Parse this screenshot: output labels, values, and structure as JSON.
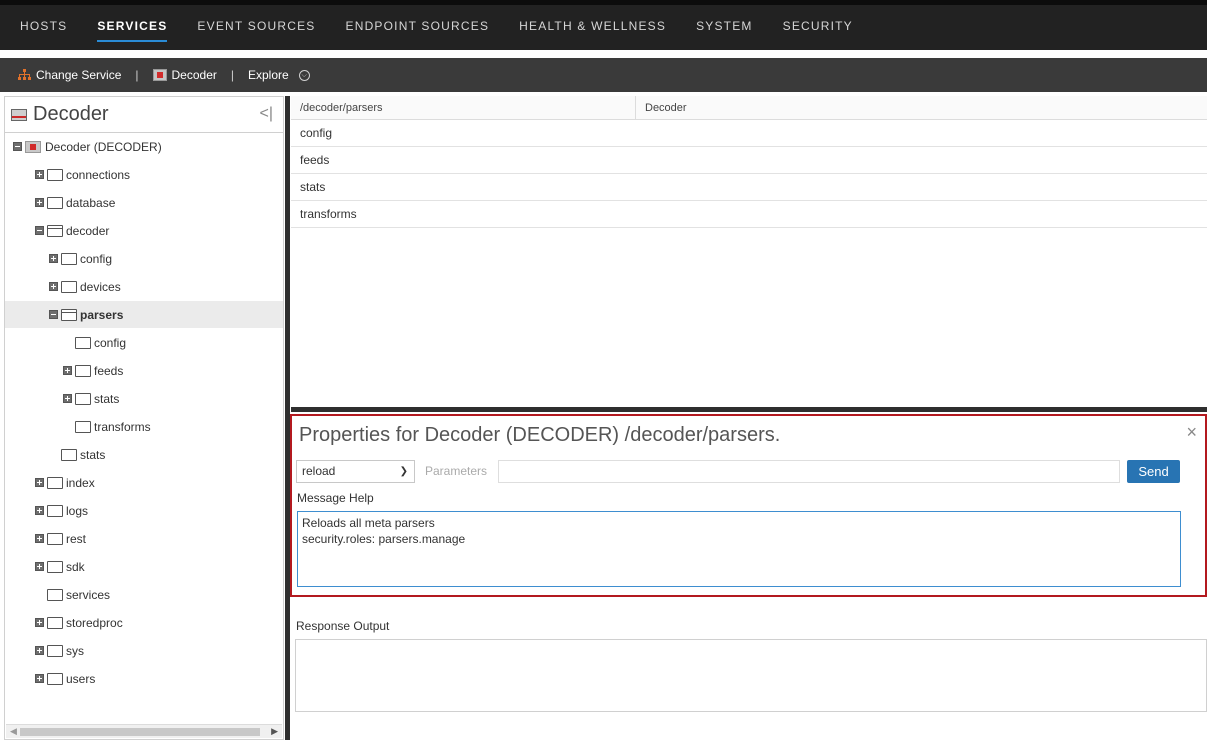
{
  "topnav": {
    "tabs": [
      "HOSTS",
      "SERVICES",
      "EVENT SOURCES",
      "ENDPOINT SOURCES",
      "HEALTH & WELLNESS",
      "SYSTEM",
      "SECURITY"
    ],
    "active": "SERVICES"
  },
  "subbar": {
    "change_service": "Change Service",
    "service_name": "Decoder",
    "view": "Explore",
    "sep": "|"
  },
  "left": {
    "title": "Decoder",
    "collapse_glyph": "<|",
    "tree": [
      {
        "label": "Decoder (DECODER)",
        "depth": 0,
        "toggle": "minus",
        "icon": "decoder-badge"
      },
      {
        "label": "connections",
        "depth": 1,
        "toggle": "plus",
        "icon": "folder"
      },
      {
        "label": "database",
        "depth": 1,
        "toggle": "plus",
        "icon": "folder"
      },
      {
        "label": "decoder",
        "depth": 1,
        "toggle": "minus",
        "icon": "folder-open"
      },
      {
        "label": "config",
        "depth": 2,
        "toggle": "plus",
        "icon": "folder"
      },
      {
        "label": "devices",
        "depth": 2,
        "toggle": "plus",
        "icon": "folder"
      },
      {
        "label": "parsers",
        "depth": 2,
        "toggle": "minus",
        "icon": "folder-open",
        "selected": true
      },
      {
        "label": "config",
        "depth": 3,
        "toggle": "none",
        "icon": "folder"
      },
      {
        "label": "feeds",
        "depth": 3,
        "toggle": "plus",
        "icon": "folder"
      },
      {
        "label": "stats",
        "depth": 3,
        "toggle": "plus",
        "icon": "folder"
      },
      {
        "label": "transforms",
        "depth": 3,
        "toggle": "none",
        "icon": "folder"
      },
      {
        "label": "stats",
        "depth": 2,
        "toggle": "none",
        "icon": "folder"
      },
      {
        "label": "index",
        "depth": 1,
        "toggle": "plus",
        "icon": "folder"
      },
      {
        "label": "logs",
        "depth": 1,
        "toggle": "plus",
        "icon": "folder"
      },
      {
        "label": "rest",
        "depth": 1,
        "toggle": "plus",
        "icon": "folder"
      },
      {
        "label": "sdk",
        "depth": 1,
        "toggle": "plus",
        "icon": "folder"
      },
      {
        "label": "services",
        "depth": 1,
        "toggle": "none",
        "icon": "folder"
      },
      {
        "label": "storedproc",
        "depth": 1,
        "toggle": "plus",
        "icon": "folder"
      },
      {
        "label": "sys",
        "depth": 1,
        "toggle": "plus",
        "icon": "folder"
      },
      {
        "label": "users",
        "depth": 1,
        "toggle": "plus",
        "icon": "folder"
      }
    ]
  },
  "table": {
    "columns": [
      "/decoder/parsers",
      "Decoder"
    ],
    "rows": [
      "config",
      "feeds",
      "stats",
      "transforms"
    ]
  },
  "props": {
    "title": "Properties for Decoder (DECODER) /decoder/parsers.",
    "close_glyph": "×",
    "message_select": "reload",
    "parameters_label": "Parameters",
    "parameters_value": "",
    "send_label": "Send",
    "message_help_label": "Message Help",
    "help_lines": [
      "Reloads all meta parsers",
      "security.roles: parsers.manage"
    ]
  },
  "response": {
    "label": "Response Output",
    "value": ""
  },
  "colors": {
    "topnav_bg": "#222222",
    "subbar_bg": "#3a3a3a",
    "accent_blue": "#2a8bd5",
    "send_button": "#2874b3",
    "highlight_border": "#b3191f",
    "decoder_badge_red": "#d12a2a"
  }
}
